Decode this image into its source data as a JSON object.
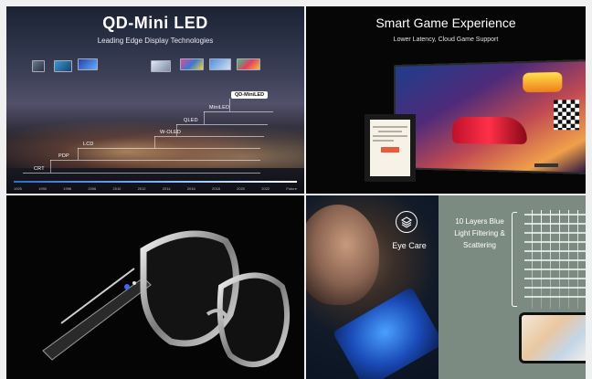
{
  "panel1": {
    "title": "QD-Mini LED",
    "subtitle": "Leading Edge Display Technologies",
    "technologies": [
      "CRT",
      "PDP",
      "LCD",
      "W-OLED",
      "QLED",
      "MiniLED",
      "QD-MiniLED"
    ],
    "years": [
      "1925",
      "1990",
      "1996",
      "2006",
      "2010",
      "2012",
      "2014",
      "2016",
      "2018",
      "2020",
      "2022",
      "Future"
    ]
  },
  "panel2": {
    "title": "Smart Game Experience",
    "subtitle": "Lower Latency, Cloud Game Support"
  },
  "panel3": {},
  "panel4": {
    "eye_care_label": "Eye Care",
    "layers_text": "10 Layers Blue Light Filtering & Scattering"
  },
  "colors": {
    "timeline_accent": "#7bb0ff",
    "eye_care_bg": "#7c8b82",
    "tag_bg": "#ffffff"
  },
  "icons": [
    "layers-icon"
  ]
}
